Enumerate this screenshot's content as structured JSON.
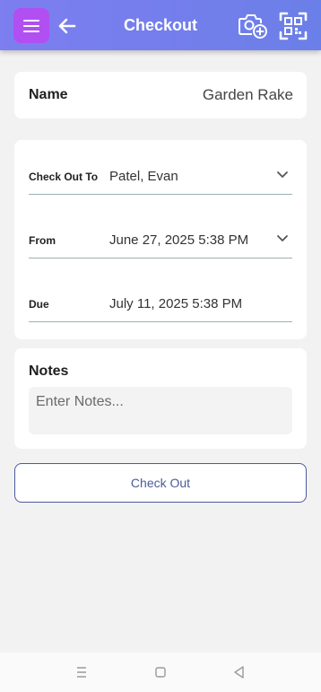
{
  "header": {
    "title": "Checkout",
    "menu_icon": "hamburger-menu-icon",
    "back_icon": "arrow-left-icon",
    "camera_icon": "camera-add-icon",
    "scan_icon": "qr-scan-icon",
    "menu_color": "#b14ff2",
    "gradient_start": "#7d7ef0",
    "gradient_end": "#6b7fe8"
  },
  "name_card": {
    "label": "Name",
    "value": "Garden Rake"
  },
  "details": {
    "check_out_to": {
      "label": "Check Out To",
      "value": "Patel, Evan"
    },
    "from": {
      "label": "From",
      "value": "June 27, 2025 5:38 PM"
    },
    "due": {
      "label": "Due",
      "value": "July 11, 2025 5:38 PM"
    }
  },
  "notes": {
    "title": "Notes",
    "placeholder": "Enter Notes...",
    "value": ""
  },
  "checkout_button": {
    "label": "Check Out",
    "color": "#4b5a9c"
  },
  "system_nav": {
    "recent_icon": "recent-apps-icon",
    "home_icon": "home-icon",
    "back_icon": "back-triangle-icon"
  }
}
